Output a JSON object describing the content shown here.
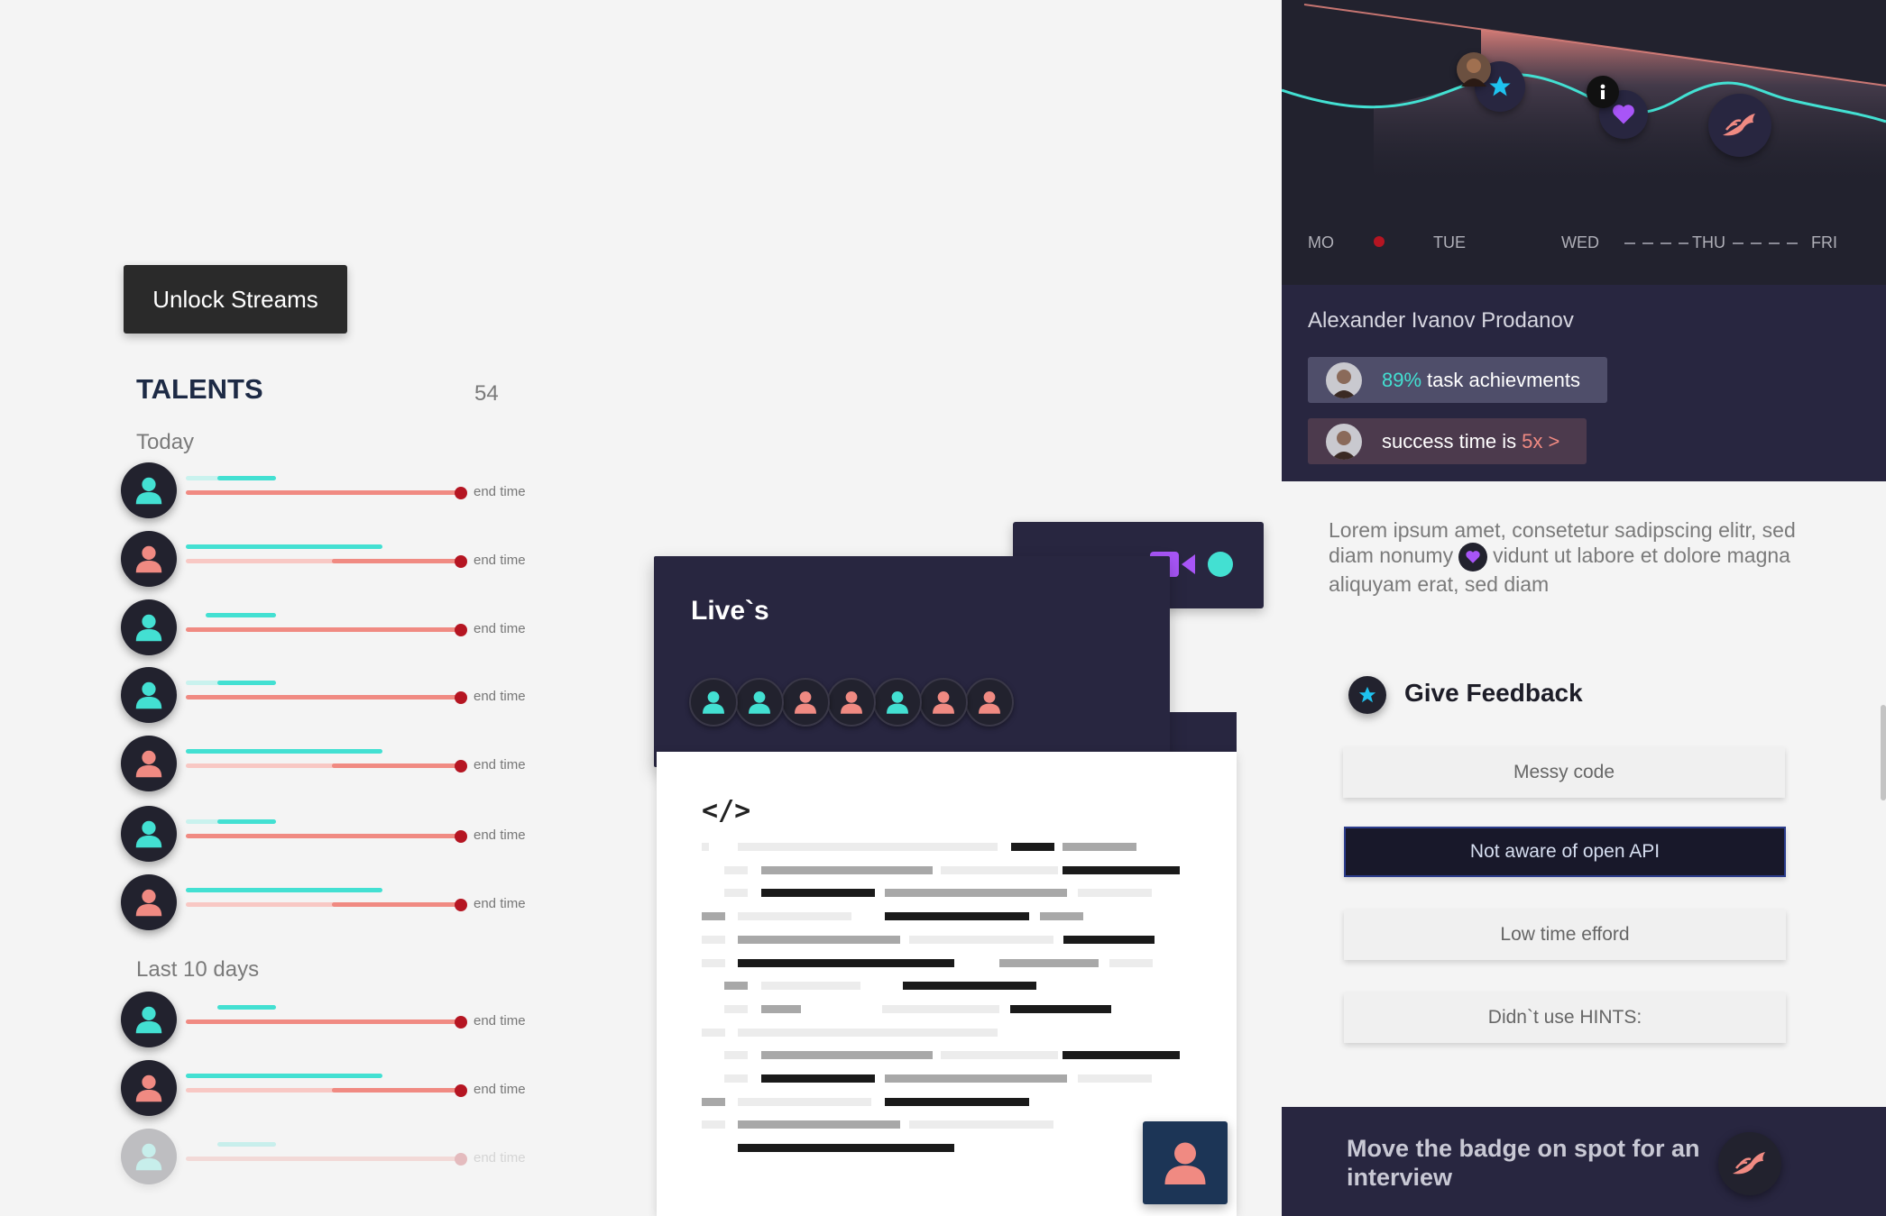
{
  "unlock_button": "Unlock Streams",
  "talents": {
    "title": "TALENTS",
    "count": "54",
    "sections": [
      "Today",
      "Last 10 days"
    ],
    "end_label": "end time"
  },
  "lives": {
    "title": "Live`s"
  },
  "chart": {
    "days": [
      "MO",
      "TUE",
      "WED",
      "THU",
      "FRI"
    ]
  },
  "profile": {
    "name": "Alexander Ivanov Prodanov",
    "pill1_value": "89%",
    "pill1_text": "task achievments",
    "pill2_text": "success time is",
    "pill2_value": "5x >"
  },
  "lorem": {
    "part1": "Lorem ipsum amet, consetetur sadipscing elitr, sed diam nonumy",
    "part2": "vidunt ut labore et dolore magna aliquyam erat, sed diam"
  },
  "feedback": {
    "title": "Give Feedback",
    "options": [
      "Messy code",
      "Not aware of open API",
      "Low time efford",
      "Didn`t use HINTS:"
    ]
  },
  "bottom": {
    "text": "Move the badge on spot for an interview"
  },
  "colors": {
    "dark": "#282640",
    "teal": "#43e0d2",
    "salmon": "#f08a82",
    "red": "#b51522",
    "purple": "#a855f7"
  }
}
